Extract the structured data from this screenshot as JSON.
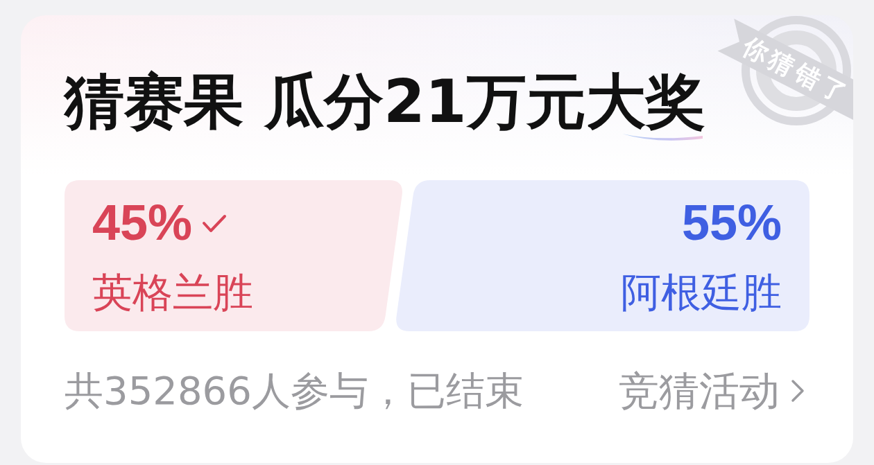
{
  "card": {
    "title": "猜赛果 瓜分21万元大奖",
    "stamp": {
      "text": "你猜错了"
    }
  },
  "options": [
    {
      "percent": "45%",
      "label": "英格兰胜",
      "level": 0.45,
      "selected": true,
      "color": "#d94457"
    },
    {
      "percent": "55%",
      "label": "阿根廷胜",
      "level": 0.55,
      "selected": false,
      "color": "#3f5fe2"
    }
  ],
  "footer": {
    "summary": "共352866人参与，已结束",
    "link": {
      "label": "竞猜活动"
    }
  }
}
